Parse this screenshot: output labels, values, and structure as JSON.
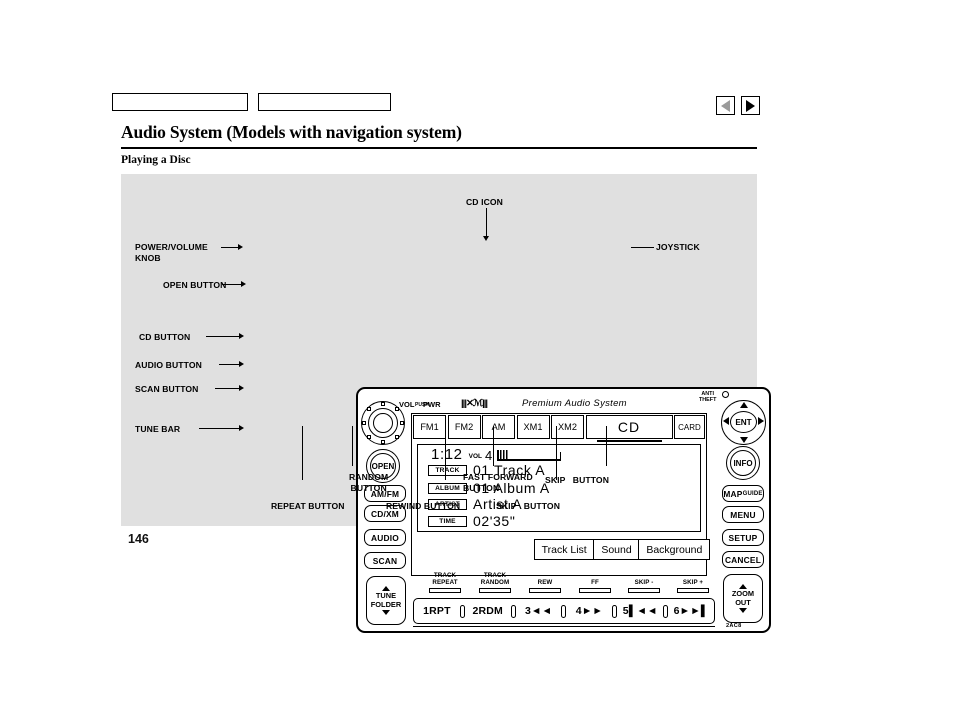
{
  "document": {
    "page_title": "Audio System (Models with navigation system)",
    "section_title": "Playing a Disc",
    "page_number": "146"
  },
  "nav": {
    "prev_icon": "triangle-left-icon",
    "next_icon": "triangle-right-icon"
  },
  "figure": {
    "callouts": {
      "cd_icon": "CD ICON",
      "joystick": "JOYSTICK",
      "power_volume_knob_l1": "POWER/VOLUME",
      "power_volume_knob_l2": "KNOB",
      "open_button": "OPEN BUTTON",
      "cd_button": "CD BUTTON",
      "audio_button": "AUDIO BUTTON",
      "scan_button": "SCAN BUTTON",
      "tune_bar": "TUNE BAR",
      "repeat_button": "REPEAT BUTTON",
      "random_button_l1": "RANDOM",
      "random_button_l2": "BUTTON",
      "rewind_button": "REWIND BUTTON",
      "fast_forward_button_l1": "FAST FORWARD",
      "fast_forward_button_l2": "BUTTON",
      "skip_minus_button_l1": "SKIP",
      "skip_minus_button_l2": "BUTTON",
      "skip_plus_button_l1": "SKIP",
      "skip_plus_button_l2": "BUTTON"
    },
    "unit": {
      "vol_label": "VOL",
      "push_label": "PUSH",
      "pwr_label": "PWR",
      "xm_logo": "|||✕ℳ|||",
      "brand_label": "Premium Audio System",
      "anti_theft_l1": "ANTI",
      "anti_theft_l2": "THEFT",
      "model_code": "2AC8",
      "left_buttons": [
        {
          "label": "OPEN",
          "name": "open-button"
        },
        {
          "label": "AM/FM",
          "name": "amfm-button"
        },
        {
          "label": "CD/XM",
          "name": "cdxm-button"
        },
        {
          "label": "AUDIO",
          "name": "audio-button"
        },
        {
          "label": "SCAN",
          "name": "scan-button"
        }
      ],
      "tune_bar_l1": "TUNE",
      "tune_bar_l2": "FOLDER",
      "right_buttons": [
        {
          "label": "INFO",
          "name": "info-button"
        },
        {
          "label": "MAP",
          "sublabel": "GUIDE",
          "name": "map-guide-button"
        },
        {
          "label": "MENU",
          "name": "menu-button"
        },
        {
          "label": "SETUP",
          "name": "setup-button"
        },
        {
          "label": "CANCEL",
          "name": "cancel-button"
        }
      ],
      "zoom_l1": "ZOOM",
      "zoom_l2": "OUT",
      "joystick_label": "ENT"
    },
    "screen": {
      "tabs": [
        {
          "label": "FM1",
          "selected": false
        },
        {
          "label": "FM2",
          "selected": false
        },
        {
          "label": "AM",
          "selected": false
        },
        {
          "label": "XM1",
          "selected": false
        },
        {
          "label": "XM2",
          "selected": false
        },
        {
          "label": "CD",
          "selected": true
        },
        {
          "label": "CARD",
          "selected": false
        }
      ],
      "clock": "1:12",
      "vol_label": "VOL",
      "vol_value": "4",
      "rows": [
        {
          "tag": "TRACK",
          "value": "01  Track A"
        },
        {
          "tag": "ALBUM",
          "value": "01  Album A"
        },
        {
          "tag": "ARTIST",
          "value": "Artist A"
        },
        {
          "tag": "TIME",
          "value": "02'35\""
        }
      ],
      "soft_buttons": [
        {
          "label": "Track  List"
        },
        {
          "label": "Sound"
        },
        {
          "label": "Background"
        }
      ]
    },
    "presets": {
      "function_labels": [
        {
          "l1": "TRACK",
          "l2": "REPEAT"
        },
        {
          "l1": "TRACK",
          "l2": "RANDOM"
        },
        {
          "l1": "REW",
          "l2": ""
        },
        {
          "l1": "FF",
          "l2": ""
        },
        {
          "l1": "SKIP -",
          "l2": ""
        },
        {
          "l1": "SKIP +",
          "l2": ""
        }
      ],
      "buttons": [
        {
          "label": "1RPT"
        },
        {
          "label": "2RDM"
        },
        {
          "label": "3◄◄"
        },
        {
          "label": "4►►"
        },
        {
          "label": "5▌◄◄"
        },
        {
          "label": "6►►▌"
        }
      ]
    }
  }
}
